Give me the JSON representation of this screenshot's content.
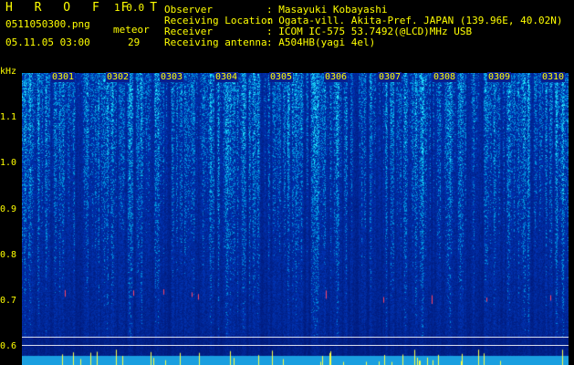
{
  "app": {
    "logo": "H R O F F T",
    "version": "1.0.0"
  },
  "file": {
    "name": "0511050300.png",
    "datetime": "05.11.05 03:00"
  },
  "counter": {
    "label": "meteor",
    "value": "29"
  },
  "info": {
    "observer_label": "Observer",
    "observer_value": ": Masayuki Kobayashi",
    "location_label": "Receiving Location",
    "location_value": ": Ogata-vill. Akita-Pref. JAPAN (139.96E, 40.02N)",
    "receiver_label": "Receiver",
    "receiver_value": ": ICOM IC-575 53.7492(@LCD)MHz USB",
    "antenna_label": "Receiving antenna",
    "antenna_value": ": A504HB(yagi 4el)"
  },
  "axis": {
    "unit": "kHz",
    "ticks": [
      "1.1",
      "1.0",
      "0.9",
      "0.8",
      "0.7",
      "0.6"
    ]
  },
  "columns": [
    "0301",
    "0302",
    "0303",
    "0304",
    "0305",
    "0306",
    "0307",
    "0308",
    "0309",
    "0310"
  ],
  "colors": {
    "background": "#000000",
    "label": "#ffff00",
    "spectrum_low": "#001a8c",
    "spectrum_high": "#2ad4ff"
  }
}
